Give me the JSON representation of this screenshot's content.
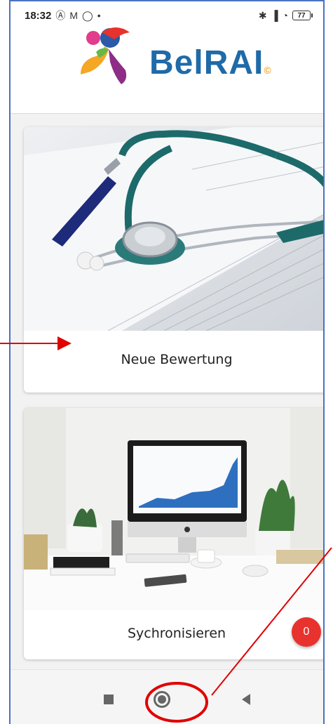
{
  "status_bar": {
    "time": "18:32",
    "left_icons": [
      "a-icon",
      "mail-icon",
      "whatsapp-icon",
      "dot"
    ],
    "right_icons": [
      "bluetooth-icon",
      "signal-icon",
      "wifi-icon"
    ],
    "battery": "77"
  },
  "header": {
    "logo_text": "BelRAI",
    "logo_suffix": "©"
  },
  "cards": [
    {
      "label": "Neue Bewertung",
      "image": "stethoscope-photo"
    },
    {
      "label": "Sychronisieren",
      "image": "desk-computer-photo",
      "badge": "0"
    }
  ],
  "nav": {
    "buttons": [
      "recents-button",
      "home-button",
      "back-button"
    ]
  },
  "colors": {
    "logo_blue": "#1f6aa8",
    "badge_red": "#e8322e",
    "annotation_red": "#e00000",
    "frame_blue": "#4a72c4"
  }
}
